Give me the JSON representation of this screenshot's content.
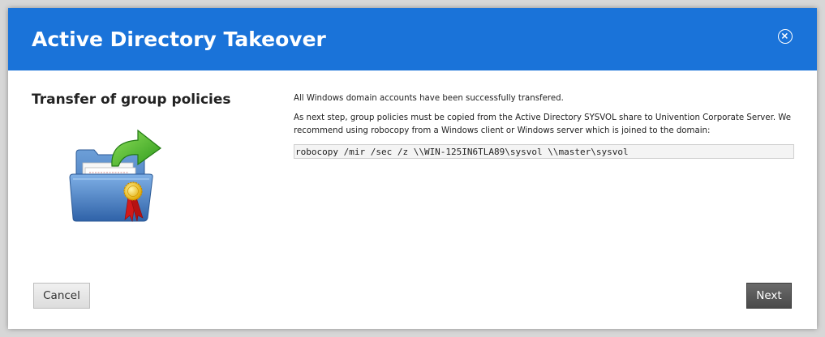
{
  "dialog": {
    "title": "Active Directory Takeover",
    "heading": "Transfer of group policies",
    "message_1": "All Windows domain accounts have been successfully transfered.",
    "message_2": "As next step, group policies must be copied from the Active Directory SYSVOL share to Univention Corporate Server. We recommend using robocopy from a Windows client or Windows server which is joined to the domain:",
    "command": "robocopy /mir /sec /z \\\\WIN-125IN6TLA89\\sysvol \\\\master\\sysvol",
    "illustration_icon": "folder-export-certificate-icon",
    "close_icon": "close-circle-icon"
  },
  "buttons": {
    "cancel_label": "Cancel",
    "next_label": "Next"
  },
  "colors": {
    "titlebar": "#1a73d9",
    "title_text": "#ffffff",
    "next_button": "#555555"
  }
}
